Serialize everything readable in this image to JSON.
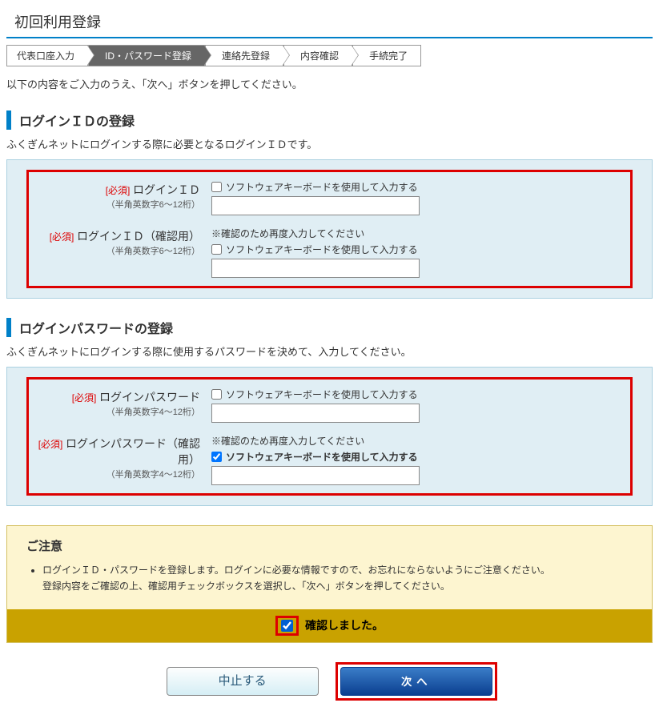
{
  "title": "初回利用登録",
  "steps": [
    "代表口座入力",
    "ID・パスワード登録",
    "連絡先登録",
    "内容確認",
    "手続完了"
  ],
  "active_step_index": 1,
  "instruction": "以下の内容をご入力のうえ、「次へ」ボタンを押してください。",
  "section1": {
    "header": "ログインＩＤの登録",
    "desc": "ふくぎんネットにログインする際に必要となるログインＩＤです。",
    "required": "[必須]",
    "fields": {
      "login_id": {
        "label": "ログインＩＤ",
        "sub": "（半角英数字6～12桁）",
        "kb": "ソフトウェアキーボードを使用して入力する"
      },
      "login_id_confirm": {
        "label": "ログインＩＤ（確認用）",
        "sub": "（半角英数字6～12桁）",
        "note": "※確認のため再度入力してください",
        "kb": "ソフトウェアキーボードを使用して入力する"
      }
    }
  },
  "section2": {
    "header": "ログインパスワードの登録",
    "desc": "ふくぎんネットにログインする際に使用するパスワードを決めて、入力してください。",
    "required": "[必須]",
    "fields": {
      "password": {
        "label": "ログインパスワード",
        "sub": "（半角英数字4～12桁）",
        "kb": "ソフトウェアキーボードを使用して入力する"
      },
      "password_confirm": {
        "label": "ログインパスワード（確認用）",
        "sub": "（半角英数字4～12桁）",
        "note": "※確認のため再度入力してください",
        "kb": "ソフトウェアキーボードを使用して入力する"
      }
    }
  },
  "caution": {
    "title": "ご注意",
    "items": [
      "ログインＩＤ・パスワードを登録します。ログインに必要な情報ですので、お忘れにならないようにご注意ください。\n登録内容をご確認の上、確認用チェックボックスを選択し、「次へ」ボタンを押してください。"
    ],
    "confirm_label": "確認しました。"
  },
  "buttons": {
    "cancel": "中止する",
    "next": "次へ"
  }
}
